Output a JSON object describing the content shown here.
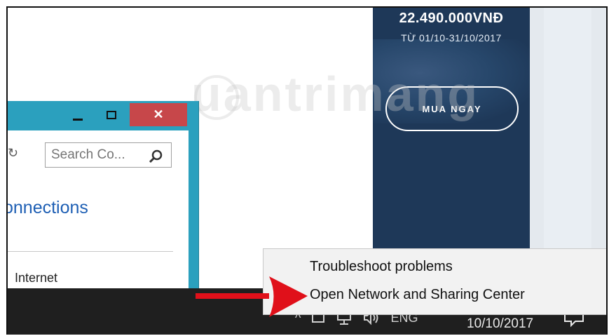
{
  "ad": {
    "price": "22.490.000VNĐ",
    "date": "TỪ 01/10-31/10/2017",
    "button_label": "MUA NGAY"
  },
  "window": {
    "minimize_icon": "minimize-icon",
    "maximize_icon": "maximize-icon",
    "close_glyph": "✕",
    "refresh_glyph": "↻",
    "search_placeholder": "Search Co...",
    "title_fragment": "onnections",
    "list_item": "Internet"
  },
  "context_menu": {
    "items": [
      {
        "label": "Troubleshoot problems"
      },
      {
        "label": "Open Network and Sharing Center"
      }
    ]
  },
  "taskbar": {
    "chevron_glyph": "^",
    "language": "ENG",
    "date": "10/10/2017"
  },
  "watermark": {
    "text": "uantrimang"
  },
  "colors": {
    "ad_background": "#1e3858",
    "window_frame": "#2ba0be",
    "close_button": "#c7474a",
    "taskbar": "#1f1f1f",
    "arrow": "#e0101a",
    "link_blue": "#1e5fb4"
  }
}
